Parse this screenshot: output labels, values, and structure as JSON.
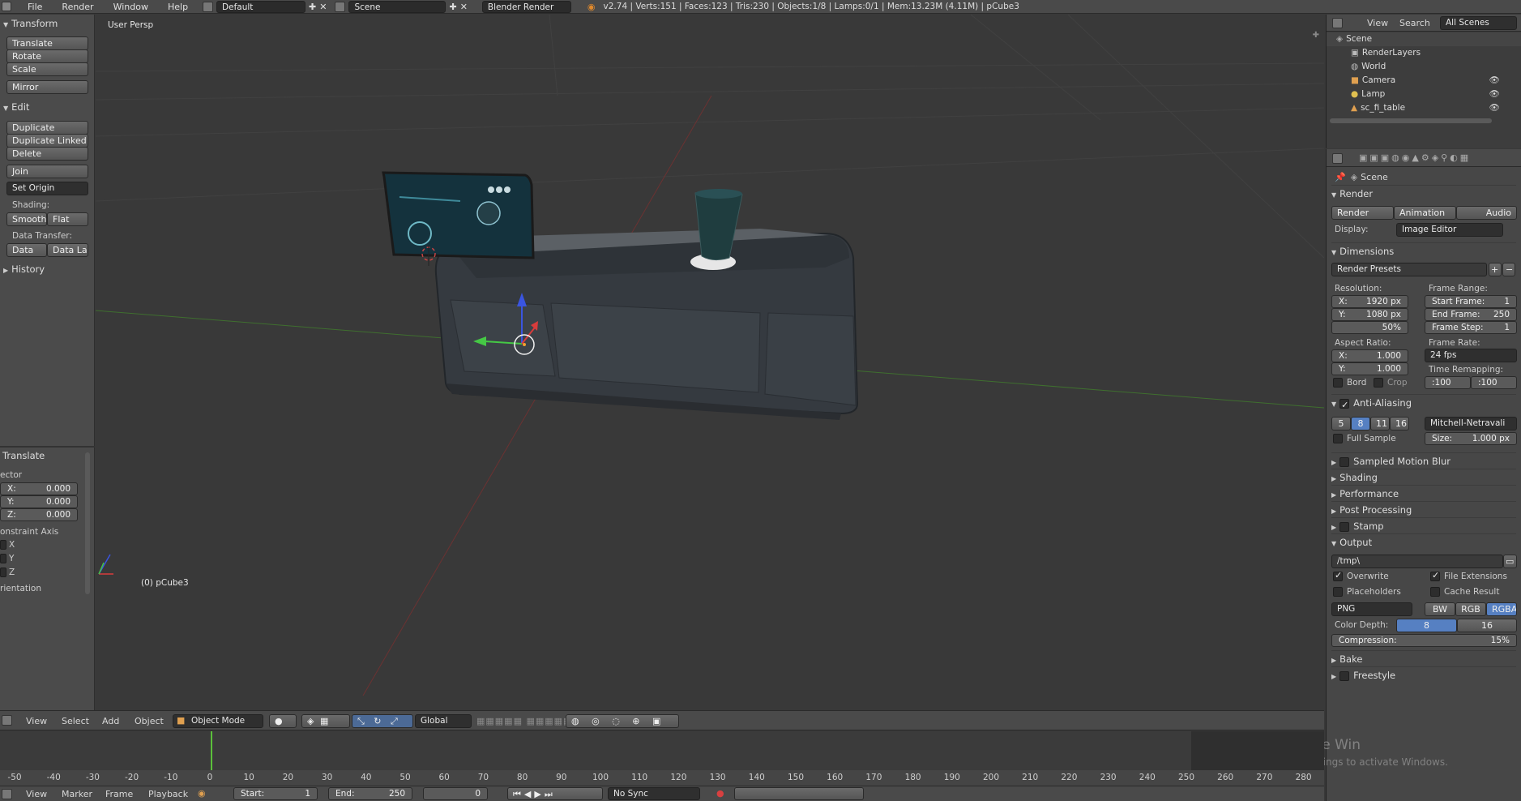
{
  "topbar": {
    "menus": [
      "File",
      "Render",
      "Window",
      "Help"
    ],
    "layout": "Default",
    "scene": "Scene",
    "engine": "Blender Render",
    "stats": "v2.74 | Verts:151 | Faces:123 | Tris:230 | Objects:1/8 | Lamps:0/1 | Mem:13.23M (4.11M) | pCube3"
  },
  "toolshelf": {
    "transform_title": "Transform",
    "translate": "Translate",
    "rotate": "Rotate",
    "scale": "Scale",
    "mirror": "Mirror",
    "edit_title": "Edit",
    "duplicate": "Duplicate",
    "duplicate_linked": "Duplicate Linked",
    "delete": "Delete",
    "join": "Join",
    "set_origin": "Set Origin",
    "shading_label": "Shading:",
    "smooth": "Smooth",
    "flat": "Flat",
    "data_transfer_label": "Data Transfer:",
    "data": "Data",
    "data_layo": "Data Layo",
    "history_title": "History"
  },
  "operator": {
    "title": "Translate",
    "vector_label": "ector",
    "x_label": "X:",
    "x_val": "0.000",
    "y_label": "Y:",
    "y_val": "0.000",
    "z_label": "Z:",
    "z_val": "0.000",
    "constraint_label": "onstraint Axis",
    "cx": "X",
    "cy": "Y",
    "cz": "Z",
    "orientation_label": "rientation"
  },
  "viewport": {
    "view_name": "User Persp",
    "object_label": "(0) pCube3"
  },
  "outliner": {
    "view": "View",
    "search": "Search",
    "all_scenes": "All Scenes",
    "items": [
      "Scene",
      "RenderLayers",
      "World",
      "Camera",
      "Lamp",
      "sc_fi_table"
    ]
  },
  "props": {
    "context": "Scene",
    "render_title": "Render",
    "render_btn": "Render",
    "animation_btn": "Animation",
    "audio_btn": "Audio",
    "display_label": "Display:",
    "display_value": "Image Editor",
    "dimensions_title": "Dimensions",
    "render_presets": "Render Presets",
    "resolution_label": "Resolution:",
    "res_x_label": "X:",
    "res_x": "1920 px",
    "res_y_label": "Y:",
    "res_y": "1080 px",
    "res_pct": "50%",
    "frame_range_label": "Frame Range:",
    "start_frame_label": "Start Frame:",
    "start_frame": "1",
    "end_frame_label": "End Frame:",
    "end_frame": "250",
    "frame_step_label": "Frame Step:",
    "frame_step": "1",
    "aspect_label": "Aspect Ratio:",
    "asp_x_label": "X:",
    "asp_x": "1.000",
    "asp_y_label": "Y:",
    "asp_y": "1.000",
    "frame_rate_label": "Frame Rate:",
    "frame_rate": "24 fps",
    "time_remap_label": "Time Remapping:",
    "remap_old": ":100",
    "remap_new": ":100",
    "bord": "Bord",
    "crop": "Crop",
    "aa_title": "Anti-Aliasing",
    "aa_samples": [
      "5",
      "8",
      "11",
      "16"
    ],
    "aa_filter": "Mitchell-Netravali",
    "full_sample": "Full Sample",
    "size_label": "Size:",
    "size_val": "1.000 px",
    "motion_blur": "Sampled Motion Blur",
    "shading": "Shading",
    "performance": "Performance",
    "post_processing": "Post Processing",
    "stamp": "Stamp",
    "output_title": "Output",
    "output_path": "/tmp\\",
    "overwrite": "Overwrite",
    "file_extensions": "File Extensions",
    "placeholders": "Placeholders",
    "cache_result": "Cache Result",
    "format": "PNG",
    "bw": "BW",
    "rgb": "RGB",
    "rgba": "RGBA",
    "color_depth_label": "Color Depth:",
    "depth_8": "8",
    "depth_16": "16",
    "compression_label": "Compression:",
    "compression": "15%",
    "bake": "Bake",
    "freestyle": "Freestyle",
    "watermark1": "Activate Win",
    "watermark2": "Go to Settings to activate Windows."
  },
  "header3d": {
    "view": "View",
    "select": "Select",
    "add": "Add",
    "object": "Object",
    "mode": "Object Mode",
    "orientation": "Global"
  },
  "timeline": {
    "ticks": [
      "-50",
      "-40",
      "-30",
      "-20",
      "-10",
      "0",
      "10",
      "20",
      "30",
      "40",
      "50",
      "60",
      "70",
      "80",
      "90",
      "100",
      "110",
      "120",
      "130",
      "140",
      "150",
      "160",
      "170",
      "180",
      "190",
      "200",
      "210",
      "220",
      "230",
      "240",
      "250",
      "260",
      "270",
      "280"
    ],
    "view": "View",
    "marker": "Marker",
    "frame": "Frame",
    "playback": "Playback",
    "start_label": "Start:",
    "start": "1",
    "end_label": "End:",
    "end": "250",
    "current": "0",
    "sync": "No Sync"
  }
}
